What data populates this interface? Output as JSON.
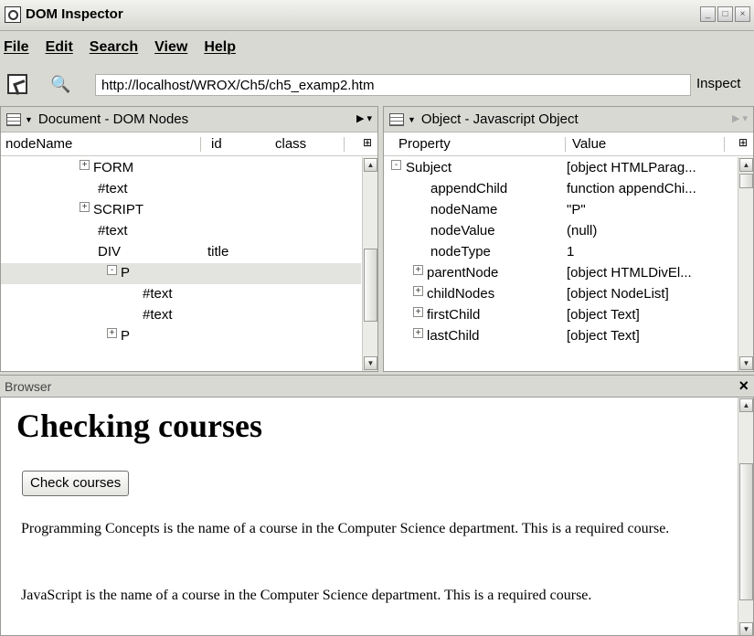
{
  "window": {
    "title": "DOM Inspector"
  },
  "menu": [
    "File",
    "Edit",
    "Search",
    "View",
    "Help"
  ],
  "toolbar": {
    "url": "http://localhost/WROX/Ch5/ch5_examp2.htm",
    "inspect_label": "Inspect"
  },
  "left_panel": {
    "title": "Document - DOM Nodes",
    "columns": {
      "name": "nodeName",
      "id": "id",
      "class": "class"
    },
    "rows": [
      {
        "twisty": "+",
        "name": "FORM",
        "id": ""
      },
      {
        "twisty": "",
        "name": "#text",
        "id": ""
      },
      {
        "twisty": "+",
        "name": "SCRIPT",
        "id": ""
      },
      {
        "twisty": "",
        "name": "#text",
        "id": ""
      },
      {
        "twisty": "",
        "name": "DIV",
        "id": "title"
      },
      {
        "twisty": "-",
        "name": "P",
        "id": ""
      },
      {
        "twisty": "",
        "name": "#text",
        "id": ""
      },
      {
        "twisty": "",
        "name": "#text",
        "id": ""
      },
      {
        "twisty": "+",
        "name": "P",
        "id": ""
      }
    ]
  },
  "right_panel": {
    "title": "Object - Javascript Object",
    "columns": {
      "property": "Property",
      "value": "Value"
    },
    "rows": [
      {
        "twisty": "-",
        "property": "Subject",
        "value": "[object HTMLParag..."
      },
      {
        "twisty": "",
        "property": "appendChild",
        "value": "function appendChi..."
      },
      {
        "twisty": "",
        "property": "nodeName",
        "value": "\"P\""
      },
      {
        "twisty": "",
        "property": "nodeValue",
        "value": "(null)"
      },
      {
        "twisty": "",
        "property": "nodeType",
        "value": "1"
      },
      {
        "twisty": "+",
        "property": "parentNode",
        "value": "[object HTMLDivEl..."
      },
      {
        "twisty": "+",
        "property": "childNodes",
        "value": "[object NodeList]"
      },
      {
        "twisty": "+",
        "property": "firstChild",
        "value": "[object Text]"
      },
      {
        "twisty": "+",
        "property": "lastChild",
        "value": "[object Text]"
      }
    ]
  },
  "browser": {
    "label": "Browser",
    "heading": "Checking courses",
    "button": "Check courses",
    "paragraphs": [
      "Programming Concepts is the name of a course in the Computer Science department. This is a required course.",
      "JavaScript is the name of a course in the Computer Science department. This is a required course."
    ]
  }
}
